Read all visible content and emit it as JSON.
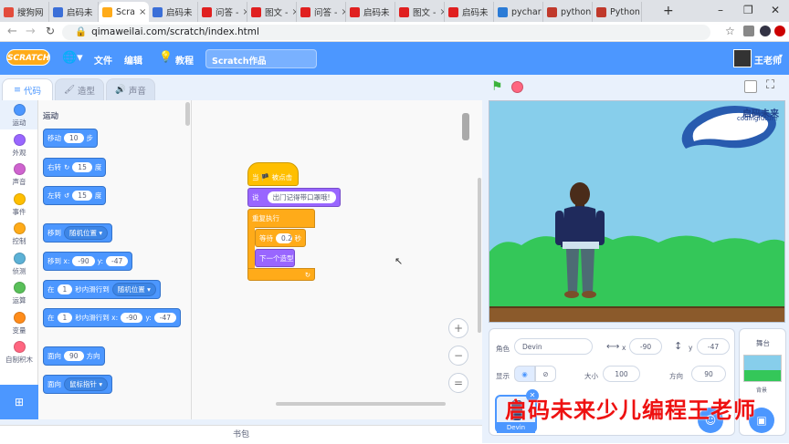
{
  "browser": {
    "tabs": [
      {
        "label": "搜狗网",
        "color": "#e34c3c"
      },
      {
        "label": "启码未",
        "color": "#3b6fd8"
      },
      {
        "label": "Scra",
        "color": "#ffab19"
      },
      {
        "label": "启码未",
        "color": "#3b6fd8"
      },
      {
        "label": "问答 -",
        "color": "#e02020"
      },
      {
        "label": "图文 -",
        "color": "#e02020"
      },
      {
        "label": "问答 -",
        "color": "#e02020"
      },
      {
        "label": "启码未",
        "color": "#e02020"
      },
      {
        "label": "图文 -",
        "color": "#e02020"
      },
      {
        "label": "启码未",
        "color": "#e02020"
      },
      {
        "label": "pychar",
        "color": "#2b7bd6"
      },
      {
        "label": "python",
        "color": "#c0392b"
      },
      {
        "label": "Python",
        "color": "#c0392b"
      }
    ],
    "new_tab": "+",
    "url": "qimaweilai.com/scratch/index.html"
  },
  "menubar": {
    "logo": "SCRATCH",
    "file": "文件",
    "edit": "编辑",
    "tutorial": "教程",
    "project_title": "Scratch作品",
    "username": "王老师"
  },
  "editor_tabs": {
    "code": "代码",
    "costumes": "造型",
    "sounds": "声音"
  },
  "categories": [
    {
      "label": "运动",
      "color": "#4c97ff"
    },
    {
      "label": "外观",
      "color": "#9966ff"
    },
    {
      "label": "声音",
      "color": "#cf63cf"
    },
    {
      "label": "事件",
      "color": "#ffbf00"
    },
    {
      "label": "控制",
      "color": "#ffab19"
    },
    {
      "label": "侦测",
      "color": "#5cb1d6"
    },
    {
      "label": "运算",
      "color": "#59c059"
    },
    {
      "label": "变量",
      "color": "#ff8c1a"
    },
    {
      "label": "自制积木",
      "color": "#ff6680"
    }
  ],
  "palette": {
    "heading": "运动",
    "move": {
      "a": "移动",
      "v": "10",
      "b": "步"
    },
    "turn_right": {
      "a": "右转",
      "icon": "↻",
      "v": "15",
      "b": "度"
    },
    "turn_left": {
      "a": "左转",
      "icon": "↺",
      "v": "15",
      "b": "度"
    },
    "goto": {
      "a": "移到",
      "d": "随机位置"
    },
    "goto_xy": {
      "a": "移到 x:",
      "x": "-90",
      "b": "y:",
      "y": "-47"
    },
    "glide": {
      "a": "在",
      "v": "1",
      "b": "秒内滑行到",
      "d": "随机位置"
    },
    "glide_xy": {
      "a": "在",
      "v": "1",
      "b": "秒内滑行到 x:",
      "x": "-90",
      "c": "y:",
      "y": "-47"
    },
    "point_dir": {
      "a": "面向",
      "v": "90",
      "b": "方向"
    },
    "point_towards": {
      "a": "面向",
      "d": "鼠标指针"
    }
  },
  "script": {
    "hat": "当 🏴 被点击",
    "say_label": "说",
    "say_text": "出门记得带口罩哦!",
    "forever": "重复执行",
    "wait_a": "等待",
    "wait_v": "0.2",
    "wait_b": "秒",
    "next_costume": "下一个造型",
    "loop_arrow": "↻"
  },
  "zoom": {
    "in": "+",
    "out": "−",
    "reset": "="
  },
  "backpack": "书包",
  "stage_logo": {
    "cn": "启码未来",
    "en": "codingfuture"
  },
  "sprite_panel": {
    "sprite_label": "角色",
    "sprite_name": "Devin",
    "x_label": "x",
    "x": "-90",
    "y_label": "y",
    "y": "-47",
    "show_label": "显示",
    "size_label": "大小",
    "size": "100",
    "direction_label": "方向",
    "direction": "90",
    "thumb_name": "Devin"
  },
  "stage_panel": {
    "label": "舞台",
    "backdrop": "背景"
  },
  "watermark": "启码未来少儿编程王老师"
}
